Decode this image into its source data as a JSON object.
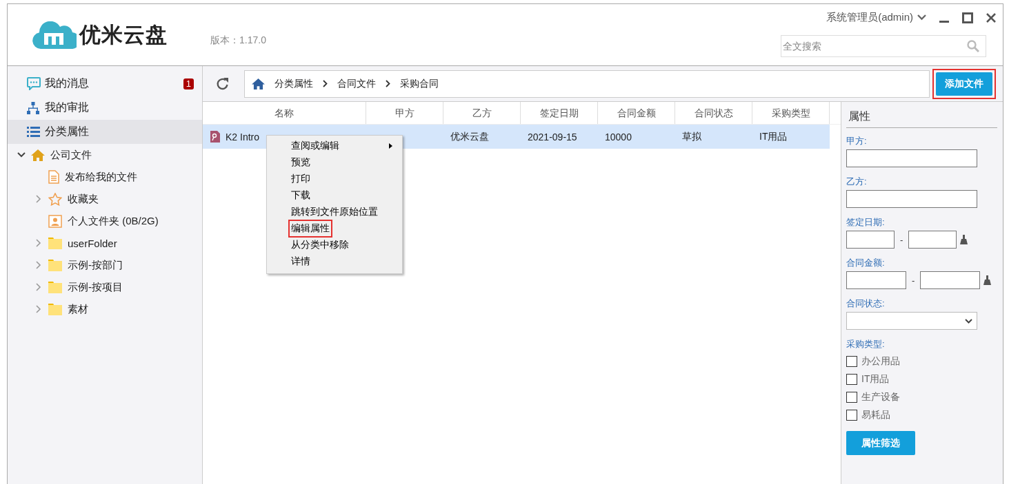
{
  "header": {
    "logo_text": "优米云盘",
    "version": "版本：1.17.0",
    "user": "系统管理员(admin)",
    "search": {
      "placeholder": "全文搜索"
    }
  },
  "sidebar": {
    "nav": [
      {
        "label": "我的消息",
        "kind": "message",
        "badge": "1",
        "selected": false
      },
      {
        "label": "我的审批",
        "kind": "approval",
        "selected": false
      },
      {
        "label": "分类属性",
        "kind": "list",
        "selected": true
      }
    ],
    "tree": [
      {
        "label": "公司文件",
        "kind": "home",
        "expanded": true,
        "children": [
          {
            "label": "发布给我的文件",
            "kind": "document"
          },
          {
            "label": "收藏夹",
            "kind": "star",
            "expanded": false
          },
          {
            "label": "个人文件夹 (0B/2G)",
            "kind": "personal"
          },
          {
            "label": "userFolder",
            "kind": "folder",
            "expanded": false
          },
          {
            "label": "示例-按部门",
            "kind": "folder",
            "expanded": false
          },
          {
            "label": "示例-按项目",
            "kind": "folder",
            "expanded": false
          },
          {
            "label": "素材",
            "kind": "folder",
            "expanded": false
          }
        ]
      }
    ]
  },
  "breadcrumb": [
    "分类属性",
    "合同文件",
    "采购合同"
  ],
  "add_button": {
    "label": "添加文件",
    "highlighted": true
  },
  "table": {
    "columns": [
      "名称",
      "甲方",
      "乙方",
      "签定日期",
      "合同金额",
      "合同状态",
      "采购类型"
    ],
    "rows": [
      {
        "selected": true,
        "name": "K2 Intro",
        "party_b": "优米云盘",
        "date": "2021-09-15",
        "amount": "10000",
        "status": "草拟",
        "type": "IT用品"
      }
    ]
  },
  "context_menu": {
    "items": [
      {
        "label": "查阅或编辑",
        "submenu": true,
        "highlighted": false
      },
      {
        "label": "预览",
        "submenu": false,
        "highlighted": false
      },
      {
        "label": "打印",
        "submenu": false,
        "highlighted": false
      },
      {
        "label": "下载",
        "submenu": false,
        "highlighted": false
      },
      {
        "label": "跳转到文件原始位置",
        "submenu": false,
        "highlighted": false
      },
      {
        "label": "编辑属性",
        "submenu": false,
        "highlighted": true
      },
      {
        "label": "从分类中移除",
        "submenu": false,
        "highlighted": false
      },
      {
        "label": "详情",
        "submenu": false,
        "highlighted": false
      }
    ]
  },
  "properties": {
    "title": "属性",
    "fields": [
      {
        "label": "甲方:",
        "kind": "text"
      },
      {
        "label": "乙方:",
        "kind": "text"
      },
      {
        "label": "签定日期:",
        "kind": "range",
        "separator": "-"
      },
      {
        "label": "合同金额:",
        "kind": "range",
        "separator": "-"
      },
      {
        "label": "合同状态:",
        "kind": "select"
      },
      {
        "label": "采购类型:",
        "kind": "checkboxes",
        "options": [
          {
            "label": "办公用品",
            "checked": false
          },
          {
            "label": "IT用品",
            "checked": false
          },
          {
            "label": "生产设备",
            "checked": false
          },
          {
            "label": "易耗品",
            "checked": false
          }
        ]
      }
    ],
    "button": "属性筛选"
  }
}
